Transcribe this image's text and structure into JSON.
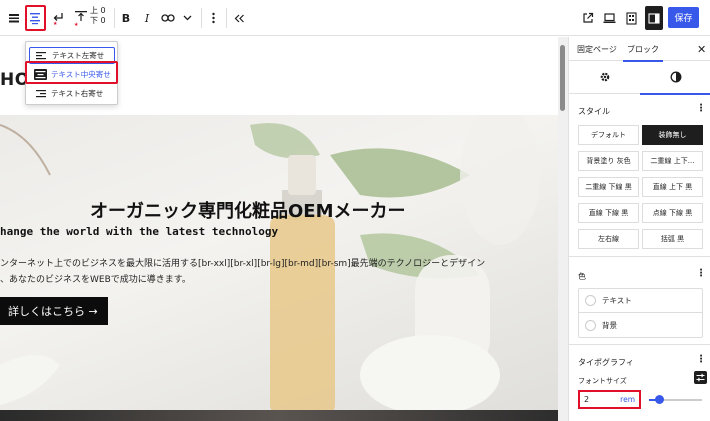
{
  "toolbar": {
    "icons": [
      "paragraph-icon",
      "align-center-icon",
      "enter-icon",
      "spacing-icon",
      "bold-icon",
      "italic-icon",
      "link-icon",
      "chevron-down-icon",
      "more-vertical-icon",
      "collapse-icon",
      "external-link-icon",
      "desktop-icon",
      "mobile-icon",
      "sidebar-toggle-icon"
    ],
    "spacing_top": "上 0",
    "spacing_bottom": "下 0",
    "save_label": "保存",
    "accent_color": "#3858e9",
    "highlight_color": "#e0102a"
  },
  "align_menu": {
    "items": [
      {
        "label": "テキスト左寄せ",
        "icon": "align-left-icon",
        "state": "focused"
      },
      {
        "label": "テキスト中央寄せ",
        "icon": "align-center-icon",
        "state": "selected"
      },
      {
        "label": "テキスト右寄せ",
        "icon": "align-right-icon",
        "state": "normal"
      }
    ]
  },
  "canvas": {
    "logo": "HO",
    "title": "オーガニック専門化粧品OEMメーカー",
    "subtitle": "hange the world with the latest technology",
    "desc_line1": "ンターネット上でのビジネスを最大限に活用する[br-xxl][br-xl][br-lg][br-md][br-sm]最先端のテクノロジーとデザイン",
    "desc_line2": "、あなたのビジネスをWEBで成功に導きます。",
    "button_label": "詳しくはこちら →"
  },
  "sidebar": {
    "tab_page": "固定ページ",
    "tab_block": "ブロック",
    "subtab_icons": [
      "gear-icon",
      "contrast-icon"
    ],
    "style_title": "スタイル",
    "styles": [
      "デフォルト",
      "装飾無し",
      "背景塗り 灰色",
      "二重線 上下...",
      "二重線 下線 黒",
      "直線 上下 黒",
      "直線 下線 黒",
      "点線 下線 黒",
      "左右線",
      "括弧 黒"
    ],
    "active_style": "装飾無し",
    "color_title": "色",
    "color_text": "テキスト",
    "color_bg": "背景",
    "typography_title": "タイポグラフィ",
    "font_size_label": "フォントサイズ",
    "font_size_value": "2",
    "font_size_unit": "rem",
    "font_size_slider": 0.2
  }
}
